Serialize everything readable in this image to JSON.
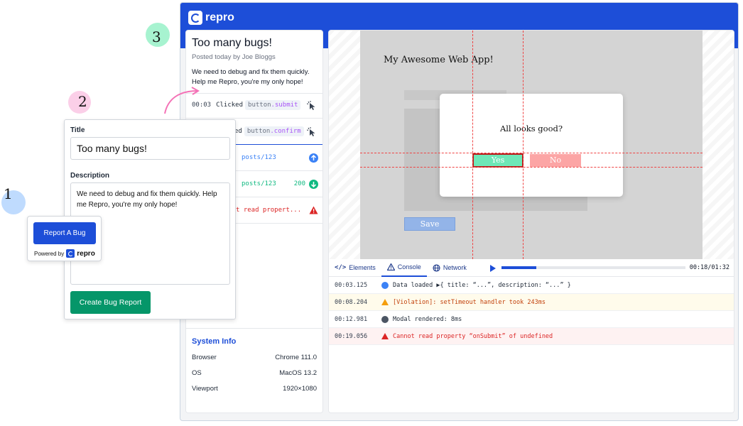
{
  "app": {
    "name": "repro"
  },
  "report": {
    "title": "Too many bugs!",
    "meta": "Posted today by Joe Bloggs",
    "description": "We need to debug and fix them quickly. Help me Repro, you're my only hope!"
  },
  "events": [
    {
      "time": "00:03",
      "action": "Clicked",
      "tag_prefix": "button",
      "tag_suffix": ".submit",
      "icon": "cursor-icon"
    },
    {
      "action_partial": "ed",
      "tag_prefix": "button",
      "tag_suffix": ".confirm",
      "icon": "cursor-icon"
    },
    {
      "text": "posts/123",
      "icon": "arrow-up-icon",
      "color": "#3b82f6"
    },
    {
      "text": "posts/123",
      "status": "200",
      "icon": "arrow-down-icon",
      "color": "#10b981"
    },
    {
      "text": "t read propert...",
      "icon": "warning-icon",
      "color": "#dc2626"
    }
  ],
  "system_info": {
    "heading": "System Info",
    "rows": [
      {
        "label": "Browser",
        "value": "Chrome 111.0"
      },
      {
        "label": "OS",
        "value": "MacOS 13.2"
      },
      {
        "label": "Viewport",
        "value": "1920×1080"
      }
    ]
  },
  "screen": {
    "site_title": "My Awesome Web App!",
    "modal_text": "All looks good?",
    "yes": "Yes",
    "no": "No",
    "save": "Save"
  },
  "devtools": {
    "tabs": [
      "Elements",
      "Console",
      "Network"
    ],
    "active_tab": "Console",
    "timer": "00:18/01:32",
    "progress": 0.19,
    "logs": [
      {
        "level": "info",
        "time": "00:03.125",
        "message": "Data loaded  ▶{ title: “...”, description: “...” }"
      },
      {
        "level": "warn",
        "time": "00:08.204",
        "message": "[Violation]: setTimeout handler took 243ms"
      },
      {
        "level": "log",
        "time": "00:12.981",
        "message": "Modal rendered: 8ms"
      },
      {
        "level": "error",
        "time": "00:19.056",
        "message": "Cannot read property “onSubmit” of undefined"
      }
    ]
  },
  "form": {
    "title_label": "Title",
    "title_value": "Too many bugs!",
    "description_label": "Description",
    "description_value": "We need to debug and fix them quickly. Help me Repro, you're my only hope!",
    "submit": "Create Bug Report"
  },
  "widget": {
    "button": "Report A Bug",
    "powered_by": "Powered by",
    "brand": "repro"
  },
  "steps": [
    "1",
    "2",
    "3"
  ],
  "colors": {
    "brand": "#1d4ed8",
    "success": "#059669",
    "step1": "#bfdbfe",
    "step2": "#fbcfe8",
    "step3": "#a7f3d0",
    "arrow": "#f472b6"
  }
}
